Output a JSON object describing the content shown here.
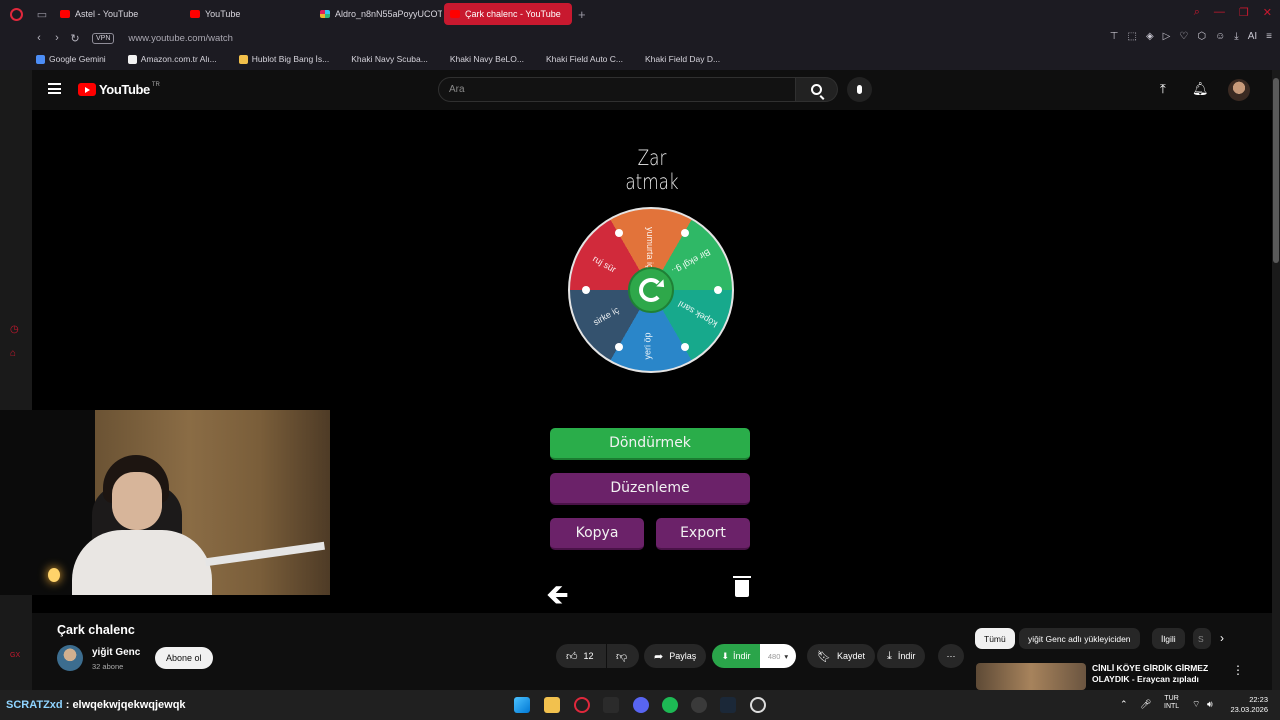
{
  "browser": {
    "tabs": [
      {
        "label": "Astel - YouTube",
        "active": false,
        "icon": "youtube-icon"
      },
      {
        "label": "YouTube",
        "active": false,
        "icon": "youtube-icon"
      },
      {
        "label": "Aldro_n8nN55aPoyyUCOT",
        "active": false,
        "icon": "slack-icon"
      },
      {
        "label": "Çark chalenc - YouTube",
        "active": true,
        "icon": "youtube-icon"
      }
    ],
    "vpn_label": "VPN",
    "url": "www.youtube.com/watch",
    "bookmarks": [
      {
        "label": "Google Gemini",
        "color": "#4c8df6"
      },
      {
        "label": "Amazon.com.tr Alı...",
        "color": "#f2f2f2"
      },
      {
        "label": "Hublot Big Bang İs...",
        "color": "#f2c04a"
      },
      {
        "label": "Khaki Navy Scuba...",
        "color": ""
      },
      {
        "label": "Khaki Navy BeLO...",
        "color": ""
      },
      {
        "label": "Khaki Field Auto C...",
        "color": ""
      },
      {
        "label": "Khaki Field Day D...",
        "color": ""
      }
    ]
  },
  "youtube": {
    "logo_text": "YouTube",
    "country_code": "TR",
    "search_placeholder": "Ara"
  },
  "video_frame": {
    "wheel_title": "Zar atmak",
    "wheel_segments": [
      "yumurta iç",
      "Bir ekgl g..",
      "köpek sarıl",
      "yeri öp",
      "sirke iç",
      "ruj sür"
    ],
    "buttons": {
      "spin": "Döndürmek",
      "edit": "Düzenleme",
      "copy": "Kopya",
      "export": "Export"
    }
  },
  "video_info": {
    "title": "Çark chalenc",
    "channel_name": "yiğit Genc",
    "subscribers": "32 abone",
    "subscribe_label": "Abone ol",
    "likes": "12",
    "share_label": "Paylaş",
    "download_ext_label": "İndir",
    "download_ext_count": "480",
    "save_label": "Kaydet",
    "download_label": "İndir"
  },
  "sidebar_chips": [
    "Tümü",
    "yiğit Genc adlı yükleyiciden",
    "İlgili",
    "S"
  ],
  "recommended": {
    "title": "CİNLİ KÖYE GİRDİK GİRMEZ OLAYDIK - Eraycan zıpladı"
  },
  "taskbar": {
    "chat_user": "SCRATZxd",
    "chat_message": "elwqekwjqekwqjewqk",
    "lang_top": "TUR",
    "lang_bottom": "INTL",
    "time": "22:23",
    "date": "23.03.2026"
  },
  "colors": {
    "accent_tab": "#c8192f",
    "spin_button": "#2aad4a",
    "purple_buttons": "#6b2269",
    "download_green": "#2aa54a"
  }
}
